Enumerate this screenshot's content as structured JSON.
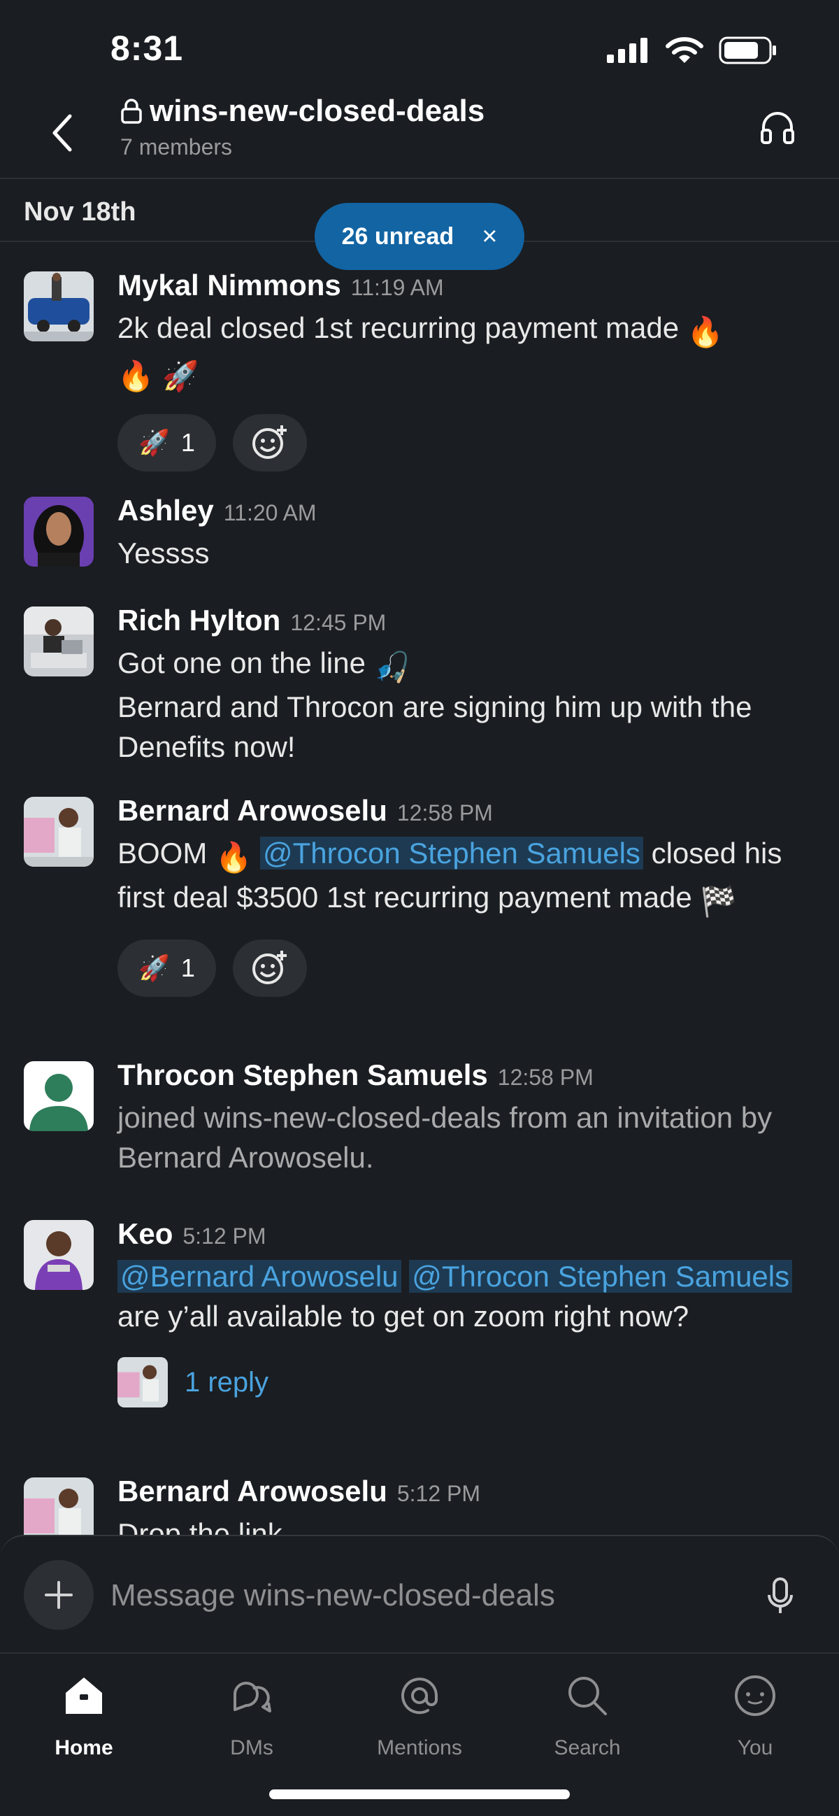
{
  "status_bar": {
    "time": "8:31"
  },
  "header": {
    "channel_name": "wins-new-closed-deals",
    "members": "7 members"
  },
  "date_divider": "Nov 18th",
  "unread_pill": {
    "label": "26 unread",
    "close": "×"
  },
  "messages": [
    {
      "author": "Mykal Nimmons",
      "time": "11:19 AM",
      "line1": "2k deal closed 1st recurring payment made ",
      "reaction_count": "1"
    },
    {
      "author": "Ashley",
      "time": "11:20 AM",
      "line1": "Yessss"
    },
    {
      "author": "Rich Hylton",
      "time": "12:45 PM",
      "line1": "Got one on the line ",
      "line2": "Bernard and Throcon are signing him up with the Denefits now!"
    },
    {
      "author": "Bernard Arowoselu",
      "time": "12:58 PM",
      "pre": "BOOM ",
      "mention": "@Throcon Stephen Samuels",
      "post": " closed his first deal $3500  1st recurring payment made ",
      "reaction_count": "1"
    },
    {
      "author": "Throcon Stephen Samuels",
      "time": "12:58 PM",
      "line1": "joined wins-new-closed-deals from an invitation by Bernard Arowoselu."
    },
    {
      "author": "Keo",
      "time": "5:12 PM",
      "mention1": "@Bernard Arowoselu",
      "mention2": "@Throcon Stephen Samuels",
      "post": " are y’all available to get on zoom right now?",
      "reply_link": "1 reply"
    },
    {
      "author": "Bernard Arowoselu",
      "time": "5:12 PM",
      "line1": "Drop the link"
    }
  ],
  "composer": {
    "placeholder": "Message wins-new-closed-deals"
  },
  "tabs": [
    {
      "label": "Home",
      "icon": "home-icon"
    },
    {
      "label": "DMs",
      "icon": "dms-icon"
    },
    {
      "label": "Mentions",
      "icon": "mentions-icon"
    },
    {
      "label": "Search",
      "icon": "search-icon"
    },
    {
      "label": "You",
      "icon": "you-icon"
    }
  ],
  "colors": {
    "background": "#1a1d21",
    "accent": "#1264a3",
    "link": "#4aa3df"
  }
}
